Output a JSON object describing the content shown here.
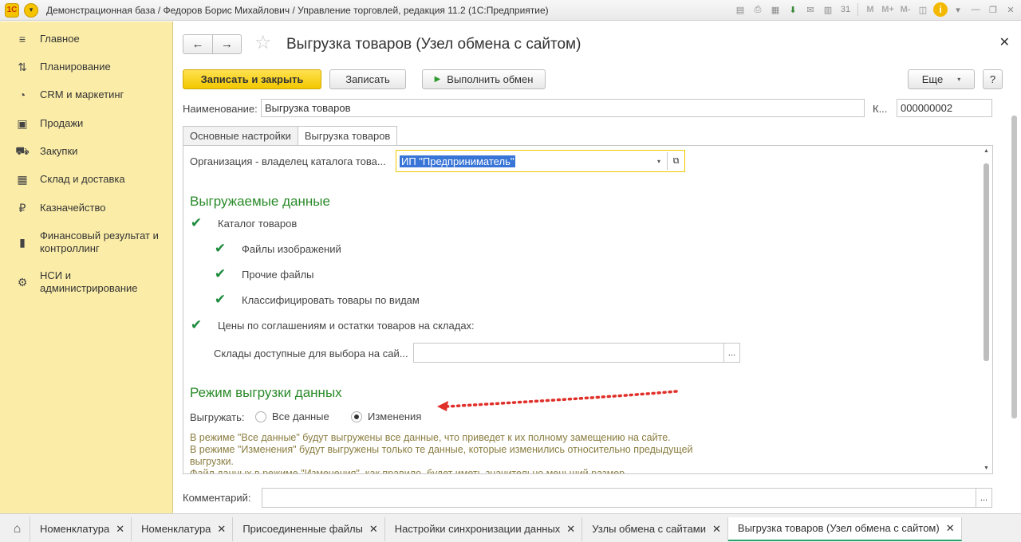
{
  "app": {
    "title": "Демонстрационная база / Федоров Борис Михайлович / Управление торговлей, редакция 11.2  (1С:Предприятие)"
  },
  "sidebar": {
    "items": [
      {
        "label": "Главное",
        "icon": "menu-icon"
      },
      {
        "label": "Планирование",
        "icon": "planning-icon"
      },
      {
        "label": "CRM и маркетинг",
        "icon": "pie-chart-icon"
      },
      {
        "label": "Продажи",
        "icon": "shopping-bag-icon"
      },
      {
        "label": "Закупки",
        "icon": "cart-icon"
      },
      {
        "label": "Склад и доставка",
        "icon": "warehouse-icon"
      },
      {
        "label": "Казначейство",
        "icon": "ruble-coin-icon"
      },
      {
        "label": "Финансовый результат и\nконтроллинг",
        "icon": "bar-chart-icon"
      },
      {
        "label": "НСИ и\nадминистрирование",
        "icon": "gear-icon"
      }
    ]
  },
  "form": {
    "title": "Выгрузка товаров (Узел обмена с сайтом)",
    "buttons": {
      "save_close": "Записать и закрыть",
      "save": "Записать",
      "run_exchange": "Выполнить обмен",
      "more": "Еще",
      "help": "?"
    },
    "name_label": "Наименование:",
    "name_value": "Выгрузка товаров",
    "code_label": "К...",
    "code_value": "000000002",
    "tabs": [
      {
        "label": "Основные настройки",
        "active": false
      },
      {
        "label": "Выгрузка товаров",
        "active": true
      }
    ],
    "org_label": "Организация - владелец каталога това...",
    "org_value": "ИП \"Предприниматель\"",
    "section_exported": "Выгружаемые данные",
    "checkboxes": {
      "catalog": "Каталог товаров",
      "image_files": "Файлы изображений",
      "other_files": "Прочие файлы",
      "classify": "Классифицировать товары по видам",
      "prices": "Цены по соглашениям и остатки товаров на складах:"
    },
    "warehouses_label": "Склады доступные для выбора на сай...",
    "warehouses_value": "",
    "section_mode": "Режим выгрузки данных",
    "export_label": "Выгружать:",
    "radio_all": "Все данные",
    "radio_changes": "Изменения",
    "radio_selected": "Изменения",
    "hint_lines": [
      "В режиме \"Все данные\" будут выгружены все данные, что приведет к их полному замещению на сайте.",
      "В режиме \"Изменения\" будут выгружены только те данные, которые изменились относительно предыдущей",
      "выгрузки.",
      "Файл данных в режиме \"Изменения\", как правило, будет иметь значительно меньший размер."
    ],
    "comment_label": "Комментарий:",
    "comment_value": ""
  },
  "taskbar": {
    "items": [
      {
        "label": "Номенклатура",
        "active": false
      },
      {
        "label": "Номенклатура",
        "active": false
      },
      {
        "label": "Присоединенные файлы",
        "active": false
      },
      {
        "label": "Настройки синхронизации данных",
        "active": false
      },
      {
        "label": "Узлы обмена с сайтами",
        "active": false
      },
      {
        "label": "Выгрузка товаров (Узел обмена с сайтом)",
        "active": true
      }
    ]
  },
  "colors": {
    "accent_yellow": "#f2c800",
    "sidebar_bg": "#fbeda8",
    "section_green": "#2a8a2a",
    "annotation_red": "#e0302a"
  }
}
